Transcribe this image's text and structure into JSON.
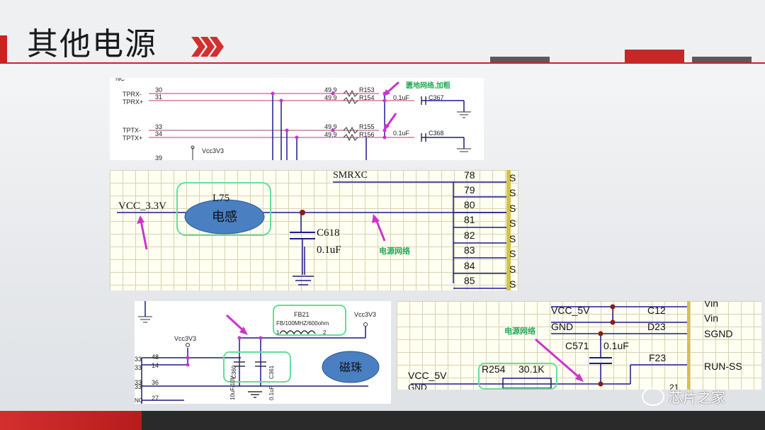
{
  "slide": {
    "title": "其他电源"
  },
  "panel1": {
    "pins": [
      {
        "name": "TPRX-",
        "num": "30",
        "res": "49.9",
        "ref": "R153"
      },
      {
        "name": "TPRX+",
        "num": "31",
        "res": "49.9",
        "ref": "R154",
        "cap": "0.1uF",
        "cref": "C367"
      },
      {
        "name": "TPTX-",
        "num": "33",
        "res": "49.9",
        "ref": "R155"
      },
      {
        "name": "TPTX+",
        "num": "34",
        "res": "49.9",
        "ref": "R156",
        "cap": "0.1uF",
        "cref": "C368"
      }
    ],
    "nc": "NC",
    "pin39": "39",
    "vcc": "Vcc3V3",
    "note": "匮地网络,加粗"
  },
  "panel2": {
    "net": "VCC_3.3V",
    "inductor_ref": "L75",
    "inductor_label": "电感",
    "cap_ref": "C618",
    "cap_val": "0.1uF",
    "note": "电源网络",
    "top_net": "SMRXC",
    "pins": [
      "78",
      "79",
      "80",
      "81",
      "82",
      "83",
      "84",
      "85"
    ],
    "pin_letter": "S"
  },
  "panel3": {
    "bead_ref": "FB21",
    "bead_val": "FB/100MHZ/600ohm",
    "bead_pin1": "1",
    "bead_pin2": "2",
    "vcc_left": "Vcc3V3",
    "vcc_right": "Vcc3V3",
    "cap1_ref": "C360",
    "cap1_val": "10uF/10V",
    "cap2_ref": "C361",
    "cap2_val": "0.1uF",
    "bead_label": "磁珠",
    "pins_left": [
      "33",
      "33",
      "33",
      "33"
    ],
    "pin48": "48",
    "pin14": "14",
    "pin36": "36",
    "pin27": "27",
    "nc": "NC"
  },
  "panel4": {
    "vcc5v_top": "VCC_5V",
    "gnd": "GND",
    "c12": "C12",
    "d23": "D23",
    "f23": "F23",
    "vin1": "Vin",
    "vin2": "Vin",
    "sgnd": "SGND",
    "runss": "RUN-SS",
    "cap_ref": "C571",
    "cap_val": "0.1uF",
    "res_ref": "R254",
    "res_val": "30.1K",
    "net": "VCC_5V",
    "gnd_bottom": "GND",
    "note": "电源网络",
    "pin_bottom": "21"
  },
  "watermark": {
    "text": "芯片之家"
  },
  "colors": {
    "accent_red": "#c62828",
    "wire": "#1a1a8c",
    "pink": "#cc33cc",
    "highlight": "#66dd99"
  }
}
